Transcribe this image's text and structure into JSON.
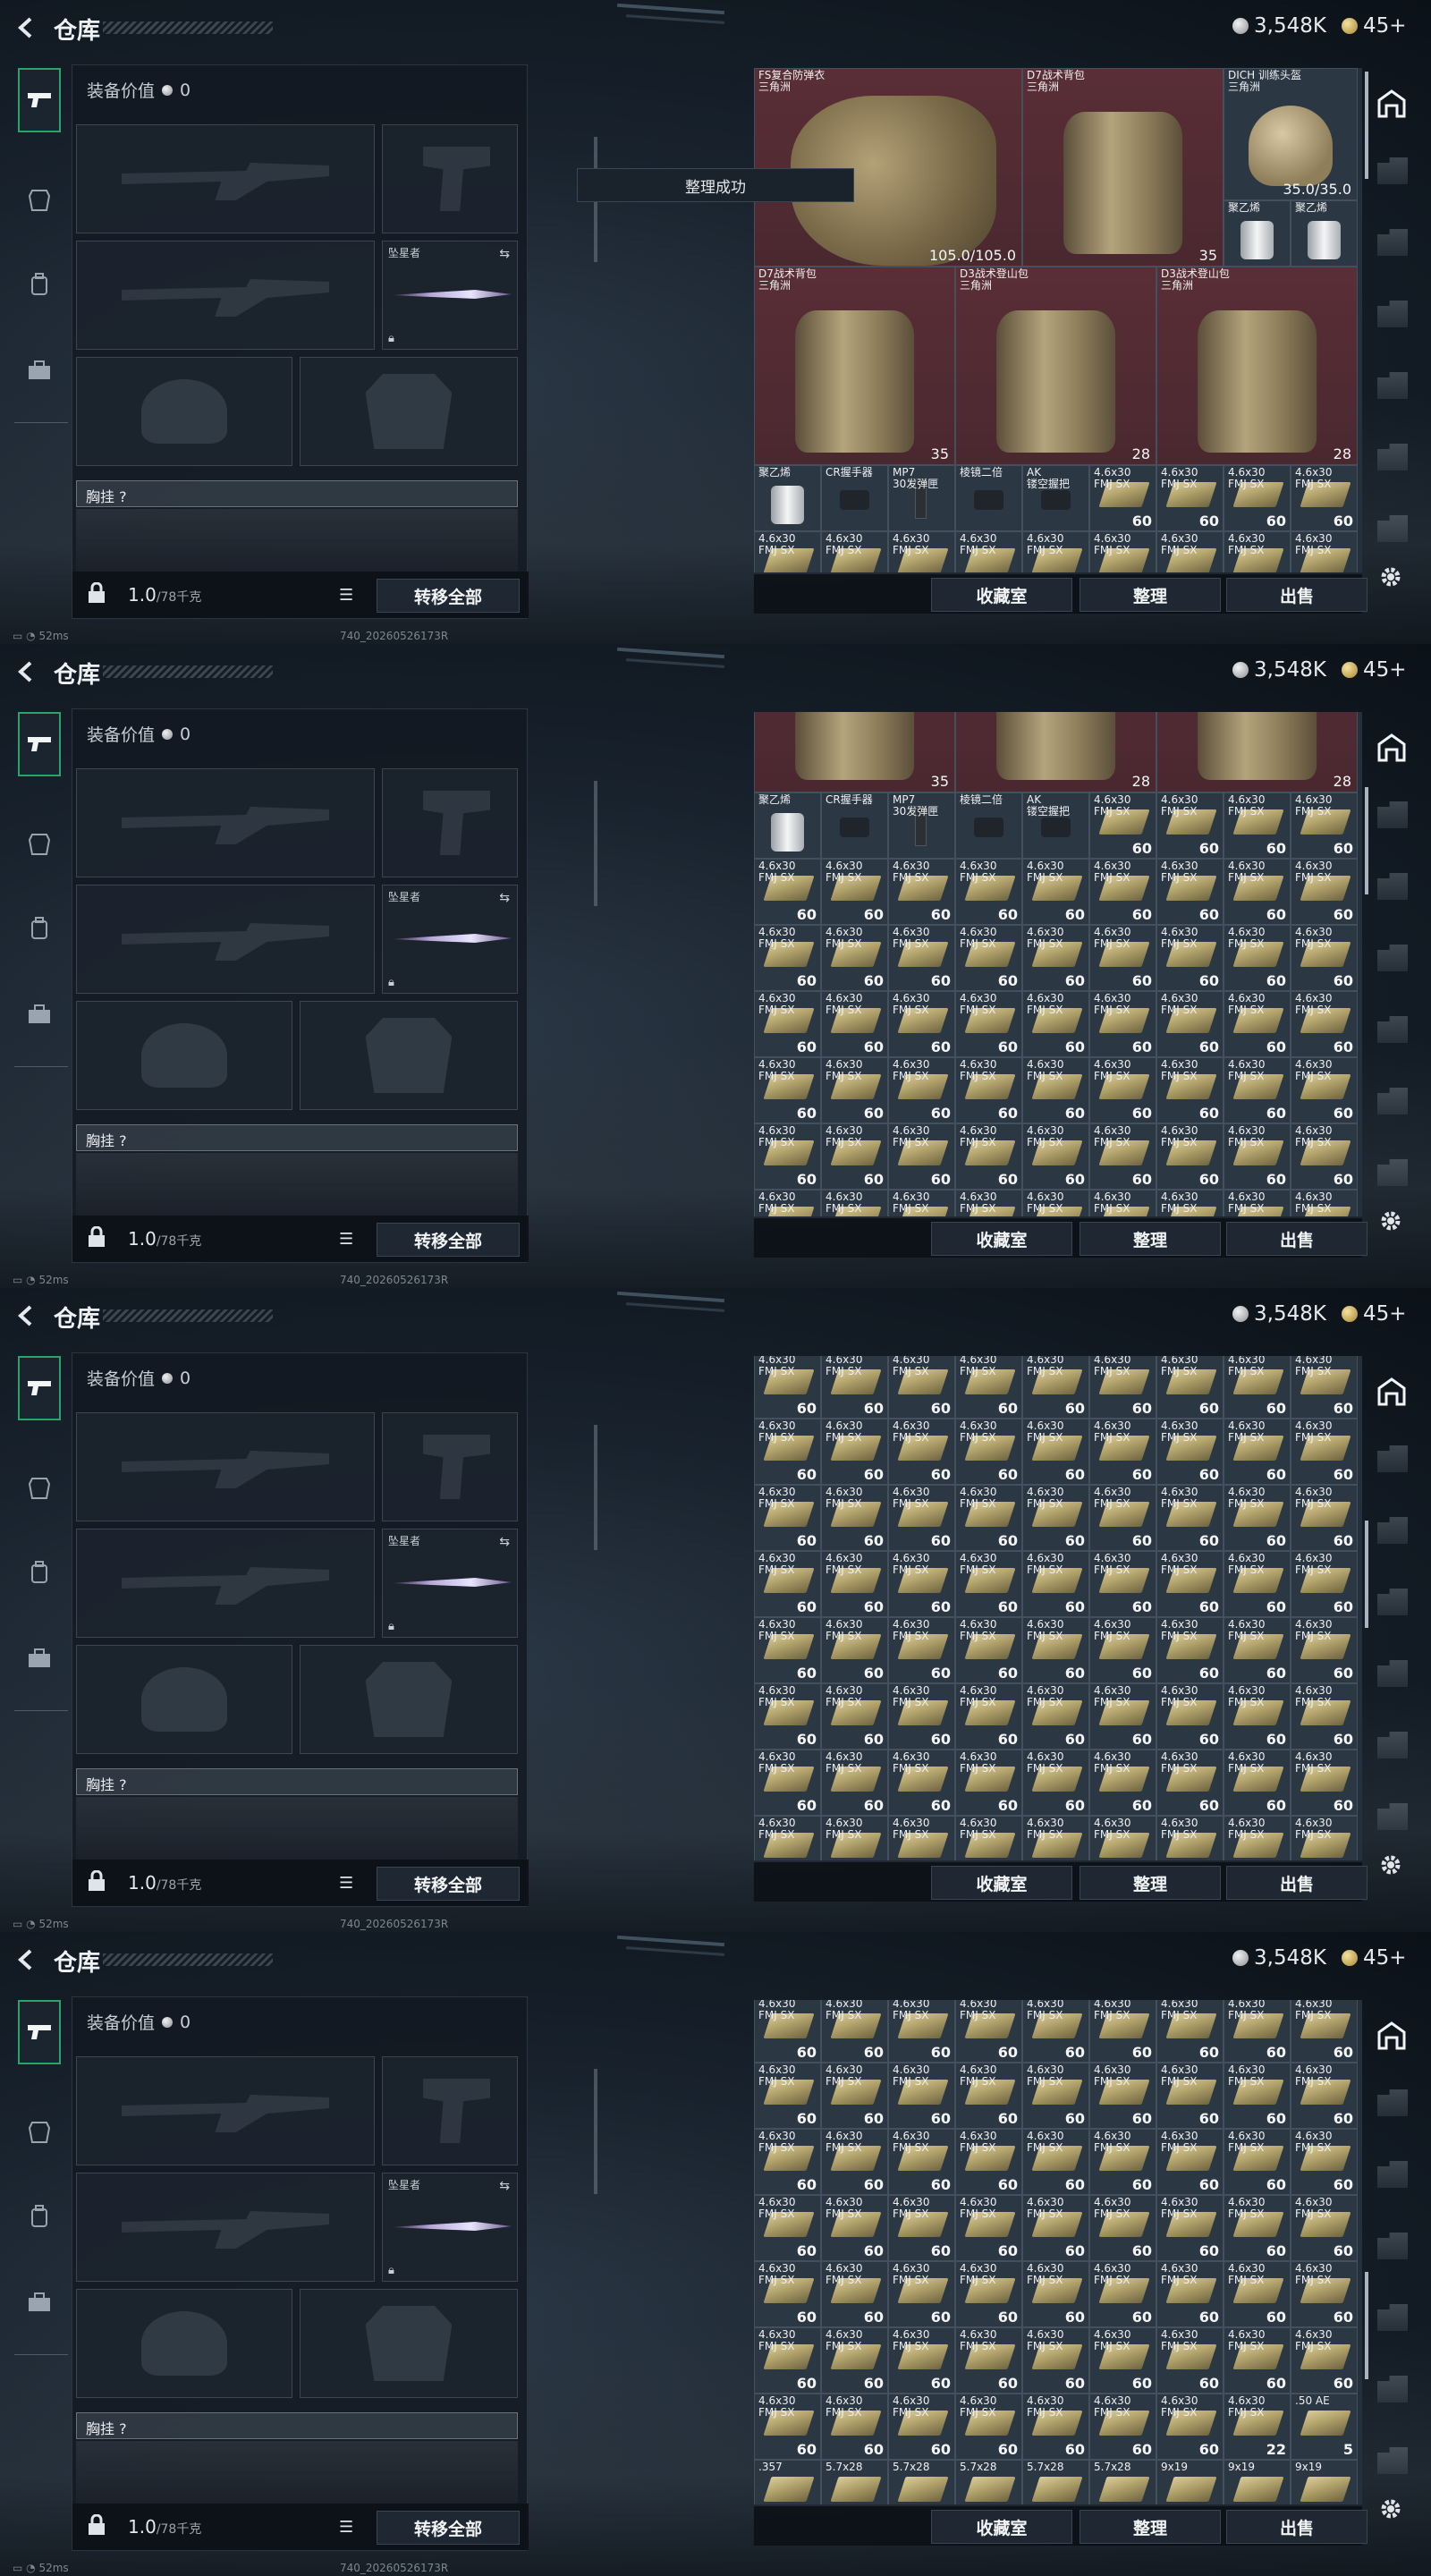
{
  "header": {
    "title": "仓库",
    "currency_silver": "3,548K",
    "currency_gold": "45+"
  },
  "equipment": {
    "value_label": "装备价值",
    "value": "0",
    "melee_label": "坠星者",
    "chest_rig_label": "胸挂",
    "chest_rig_help": "?",
    "weight_value": "1.0",
    "weight_max": "/78千克",
    "transfer_all": "转移全部"
  },
  "toast": "整理成功",
  "actions": {
    "collection": "收藏室",
    "organize": "整理",
    "sell": "出售"
  },
  "footer": {
    "ping": "52ms",
    "build": "740_20260526173R"
  },
  "stash": {
    "top_items": [
      {
        "name": "FS复合防弹衣",
        "sub": "三角洲",
        "value": "105.0/105.0"
      },
      {
        "name": "D7战术背包",
        "sub": "三角洲",
        "value": "35"
      },
      {
        "name": "DICH 训练头盔",
        "sub": "三角洲",
        "value": "35.0/35.0"
      },
      {
        "name": "聚乙烯",
        "sub": "",
        "value": ""
      },
      {
        "name": "聚乙烯",
        "sub": "",
        "value": ""
      },
      {
        "name": "D7战术背包",
        "sub": "三角洲",
        "value": "35"
      },
      {
        "name": "D3战术登山包",
        "sub": "三角洲",
        "value": "28"
      },
      {
        "name": "D3战术登山包",
        "sub": "三角洲",
        "value": "28"
      }
    ],
    "misc_items": [
      {
        "name": "聚乙烯",
        "qty": ""
      },
      {
        "name": "CR握手器",
        "qty": ""
      },
      {
        "name": "MP7\n30发弹匣",
        "qty": ""
      },
      {
        "name": "棱镜二倍",
        "qty": ""
      },
      {
        "name": "AK\n镂空握把",
        "qty": ""
      }
    ],
    "ammo_name": "4.6x30\nFMJ SX",
    "ammo_qty": "60",
    "last_row_s4": [
      {
        "name": "4.6x30\nFMJ SX",
        "qty": "60"
      },
      {
        "name": "4.6x30\nFMJ SX",
        "qty": "60"
      },
      {
        "name": "4.6x30\nFMJ SX",
        "qty": "60"
      },
      {
        "name": "4.6x30\nFMJ SX",
        "qty": "60"
      },
      {
        "name": "4.6x30\nFMJ SX",
        "qty": "60"
      },
      {
        "name": "4.6x30\nFMJ SX",
        "qty": "60"
      },
      {
        "name": "4.6x30\nFMJ SX",
        "qty": "60"
      },
      {
        "name": "4.6x30\nFMJ SX",
        "qty": "22"
      },
      {
        "name": ".50 AE",
        "qty": "5"
      }
    ],
    "bottom_row_s4": [
      ".357",
      "5.7x28",
      "5.7x28",
      "5.7x28",
      "5.7x28",
      "5.7x28",
      "9x19",
      "9x19",
      "9x19"
    ]
  },
  "icons": [
    "back-arrow-icon",
    "pistol-icon",
    "armor-icon",
    "backpack-icon",
    "briefcase-icon",
    "lock-icon",
    "list-icon",
    "swap-icon",
    "home-icon",
    "gear-icon",
    "wifi-icon",
    "battery-icon"
  ]
}
